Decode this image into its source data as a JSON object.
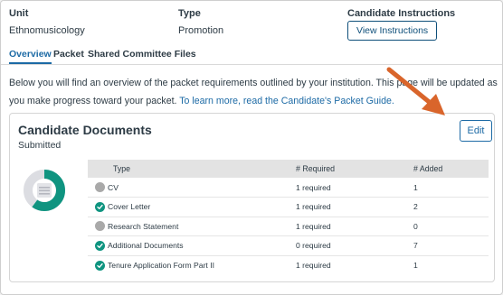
{
  "header": {
    "unit_label": "Unit",
    "unit_value": "Ethnomusicology",
    "type_label": "Type",
    "type_value": "Promotion",
    "instructions_label": "Candidate Instructions",
    "instructions_button": "View Instructions"
  },
  "tabs": [
    {
      "label": "Overview",
      "active": true
    },
    {
      "label": "Packet",
      "active": false
    },
    {
      "label": "Shared Committee Files",
      "active": false
    }
  ],
  "intro": {
    "text": "Below you will find an overview of the packet requirements outlined by your institution. This page will be updated as you make progress toward your packet.",
    "link": "To learn more, read the Candidate's Packet Guide."
  },
  "card": {
    "title": "Candidate Documents",
    "subtitle": "Submitted",
    "edit_button": "Edit",
    "progress": {
      "complete": 3,
      "total": 5
    },
    "columns": [
      "Type",
      "# Required",
      "# Added"
    ],
    "rows": [
      {
        "status": "incomplete",
        "type": "CV",
        "required": "1 required",
        "added": "1"
      },
      {
        "status": "complete",
        "type": "Cover Letter",
        "required": "1 required",
        "added": "2"
      },
      {
        "status": "incomplete",
        "type": "Research Statement",
        "required": "1 required",
        "added": "0"
      },
      {
        "status": "complete",
        "type": "Additional Documents",
        "required": "0 required",
        "added": "7"
      },
      {
        "status": "complete",
        "type": "Tenure Application Form Part II",
        "required": "1 required",
        "added": "1"
      }
    ]
  },
  "colors": {
    "accent": "#1c6aa5",
    "complete": "#0f9480",
    "incomplete": "#a9a9a9",
    "arrow": "#d9652b"
  }
}
